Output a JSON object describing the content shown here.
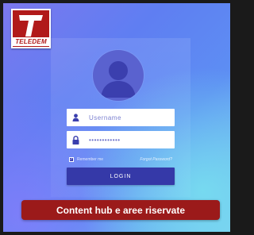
{
  "logo": {
    "brand": "TELEDEM",
    "mark": "T"
  },
  "login_form": {
    "username_placeholder": "Username",
    "password_value": "••••••••••••",
    "remember_label": "Remember me",
    "forgot_label": "Forgot Password?",
    "login_label": "LOGIN"
  },
  "banner": {
    "label": "Content hub e aree riservate"
  },
  "colors": {
    "brand_red": "#9b1a1a",
    "button_blue": "#3539a8",
    "icon_blue": "#3a3fae"
  }
}
